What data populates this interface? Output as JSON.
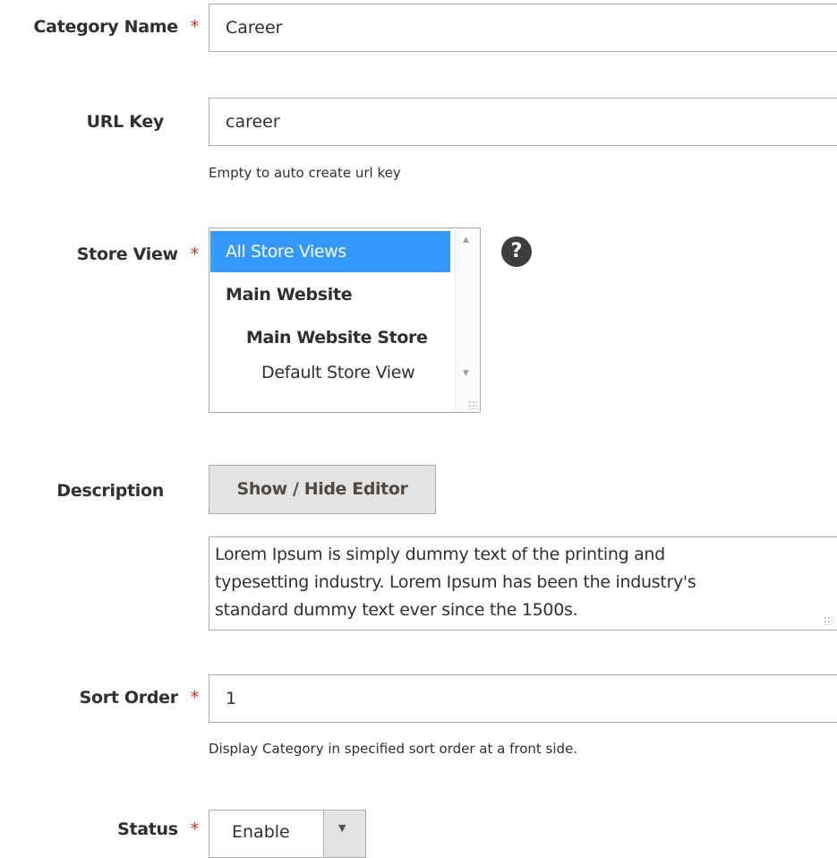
{
  "form": {
    "category_name": {
      "label": "Category Name",
      "required": "*",
      "value": "Career"
    },
    "url_key": {
      "label": "URL Key",
      "value": "career",
      "note": "Empty to auto create url key"
    },
    "store_view": {
      "label": "Store View",
      "required": "*",
      "options": [
        "All Store Views",
        "Main Website",
        "Main Website Store",
        "Default Store View"
      ],
      "help_icon": "question-circle-icon",
      "help_glyph": "?"
    },
    "description": {
      "label": "Description",
      "toggle_button": "Show / Hide Editor",
      "value": "Lorem Ipsum is simply dummy text of the printing and\ntypesetting industry. Lorem Ipsum has been the industry's\nstandard dummy text ever since the 1500s."
    },
    "sort_order": {
      "label": "Sort Order",
      "required": "*",
      "value": "1",
      "note": "Display Category in specified sort order at a front side."
    },
    "status": {
      "label": "Status",
      "required": "*",
      "value": "Enable"
    }
  },
  "colors": {
    "required": "#e22626",
    "selected_option": "#3399ff",
    "button_bg": "#e3e3e3"
  }
}
